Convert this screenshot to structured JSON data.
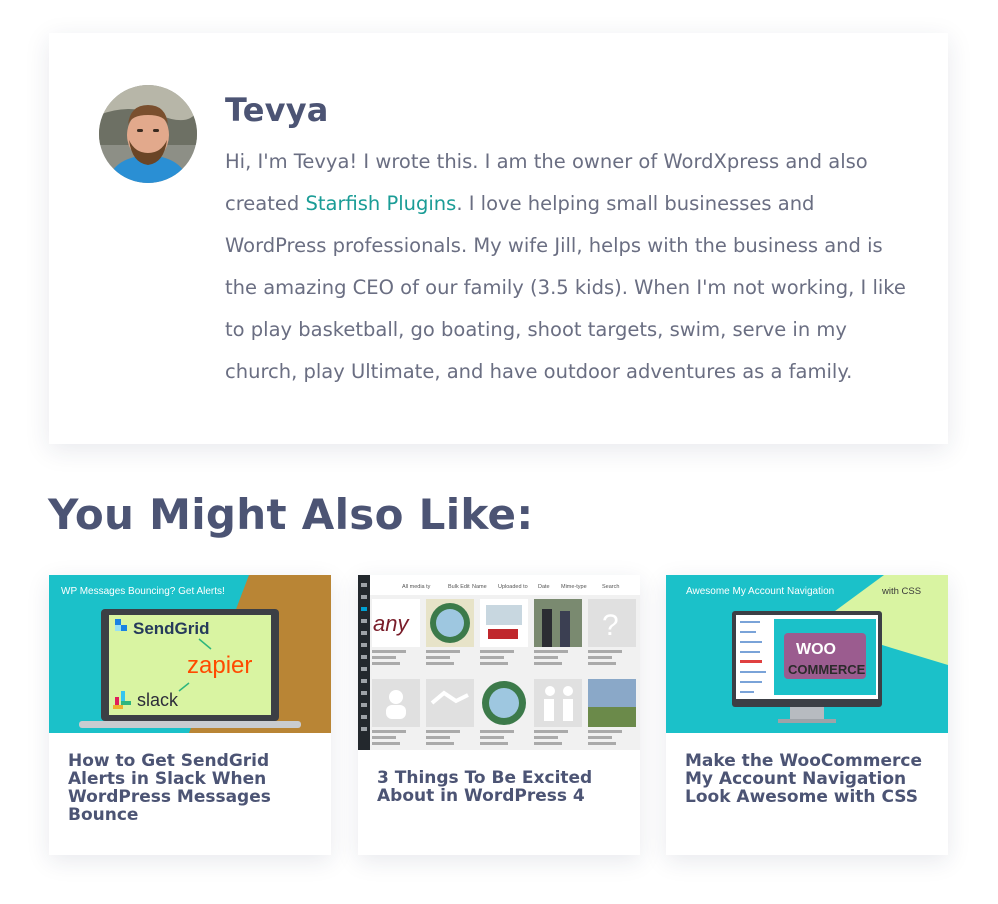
{
  "author": {
    "name": "Tevya",
    "bio_before_link": "Hi, I'm Tevya! I wrote this. I am the owner of WordXpress and also created ",
    "bio_link": "Starfish Plugins",
    "bio_after_link": ". I love helping small businesses and WordPress professionals. My wife Jill, helps with the business and is the amazing CEO of our family (3.5 kids). When I'm not working, I like to play basketball, go boating, shoot targets, swim, serve in my church, play Ultimate, and have outdoor adventures as a family."
  },
  "related": {
    "heading": "You Might Also Like:",
    "cards": [
      {
        "title": "How to Get SendGrid Alerts in Slack When WordPress Messages Bounce",
        "thumb_banner": "WP Messages Bouncing? Get Alerts!",
        "thumb_labels": [
          "SendGrid",
          "zapier",
          "slack"
        ]
      },
      {
        "title": "3 Things To Be Excited About in WordPress 4",
        "thumb_toolbar": [
          "All media ty",
          "Bulk Edit",
          "Name",
          "Uploaded to",
          "Date",
          "Mime-type",
          "Search"
        ]
      },
      {
        "title": "Make the WooCommerce My Account Navigation Look Awesome with CSS",
        "thumb_banner": "Awesome My Account Navigation",
        "thumb_banner_right": "with CSS",
        "thumb_logo": [
          "WOO",
          "COMMERCE"
        ]
      }
    ]
  },
  "colors": {
    "heading": "#4c5474",
    "body_text": "#6a6e82",
    "link": "#1a9c96",
    "teal": "#1bc1c9",
    "orange": "#b98535",
    "lime": "#d9f4a2",
    "woo_purple": "#9b5c8f"
  }
}
